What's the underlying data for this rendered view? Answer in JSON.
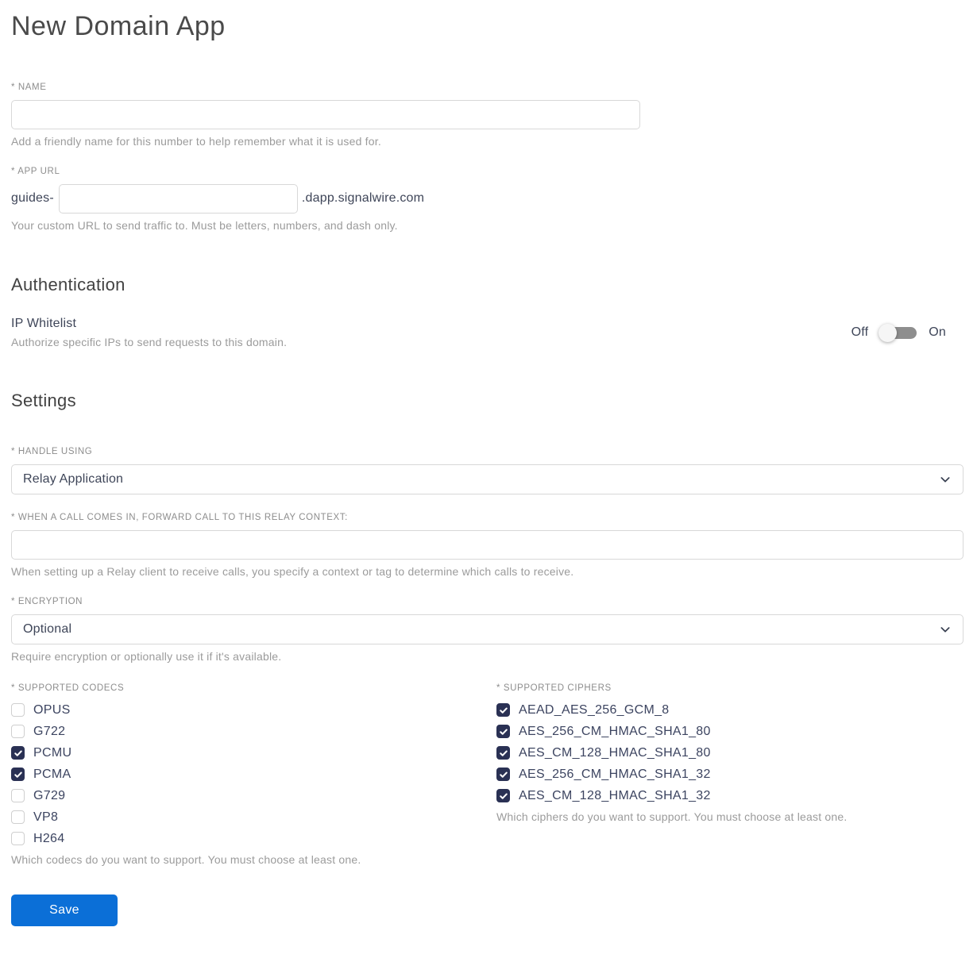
{
  "page": {
    "title": "New Domain App"
  },
  "name_field": {
    "label": "* NAME",
    "value": "",
    "helper": "Add a friendly name for this number to help remember what it is used for."
  },
  "app_url_field": {
    "label": "* APP URL",
    "prefix": "guides-",
    "value": "",
    "suffix": ".dapp.signalwire.com",
    "helper": "Your custom URL to send traffic to. Must be letters, numbers, and dash only."
  },
  "authentication": {
    "heading": "Authentication",
    "ip_whitelist": {
      "label": "IP Whitelist",
      "helper": "Authorize specific IPs to send requests to this domain.",
      "off_label": "Off",
      "on_label": "On",
      "state": "off"
    }
  },
  "settings": {
    "heading": "Settings",
    "handle_using": {
      "label": "* HANDLE USING",
      "value": "Relay Application"
    },
    "relay_context": {
      "label": "* WHEN A CALL COMES IN, FORWARD CALL TO THIS RELAY CONTEXT:",
      "value": "",
      "helper": "When setting up a Relay client to receive calls, you specify a context or tag to determine which calls to receive."
    },
    "encryption": {
      "label": "* ENCRYPTION",
      "value": "Optional",
      "helper": "Require encryption or optionally use it if it's available."
    },
    "codecs": {
      "label": "* SUPPORTED CODECS",
      "options": [
        {
          "label": "OPUS",
          "checked": false
        },
        {
          "label": "G722",
          "checked": false
        },
        {
          "label": "PCMU",
          "checked": true
        },
        {
          "label": "PCMA",
          "checked": true
        },
        {
          "label": "G729",
          "checked": false
        },
        {
          "label": "VP8",
          "checked": false
        },
        {
          "label": "H264",
          "checked": false
        }
      ],
      "helper": "Which codecs do you want to support. You must choose at least one."
    },
    "ciphers": {
      "label": "* SUPPORTED CIPHERS",
      "options": [
        {
          "label": "AEAD_AES_256_GCM_8",
          "checked": true
        },
        {
          "label": "AES_256_CM_HMAC_SHA1_80",
          "checked": true
        },
        {
          "label": "AES_CM_128_HMAC_SHA1_80",
          "checked": true
        },
        {
          "label": "AES_256_CM_HMAC_SHA1_32",
          "checked": true
        },
        {
          "label": "AES_CM_128_HMAC_SHA1_32",
          "checked": true
        }
      ],
      "helper": "Which ciphers do you want to support. You must choose at least one."
    }
  },
  "actions": {
    "save_label": "Save"
  },
  "colors": {
    "primary_button": "#0b6fd7",
    "checkbox_checked": "#2a3154",
    "toggle_track": "#8e8e8e",
    "input_border": "#d8d8d8",
    "label_gray": "#8d8d8d",
    "helper_gray": "#9b9b9b",
    "body_text": "#3e4558"
  }
}
